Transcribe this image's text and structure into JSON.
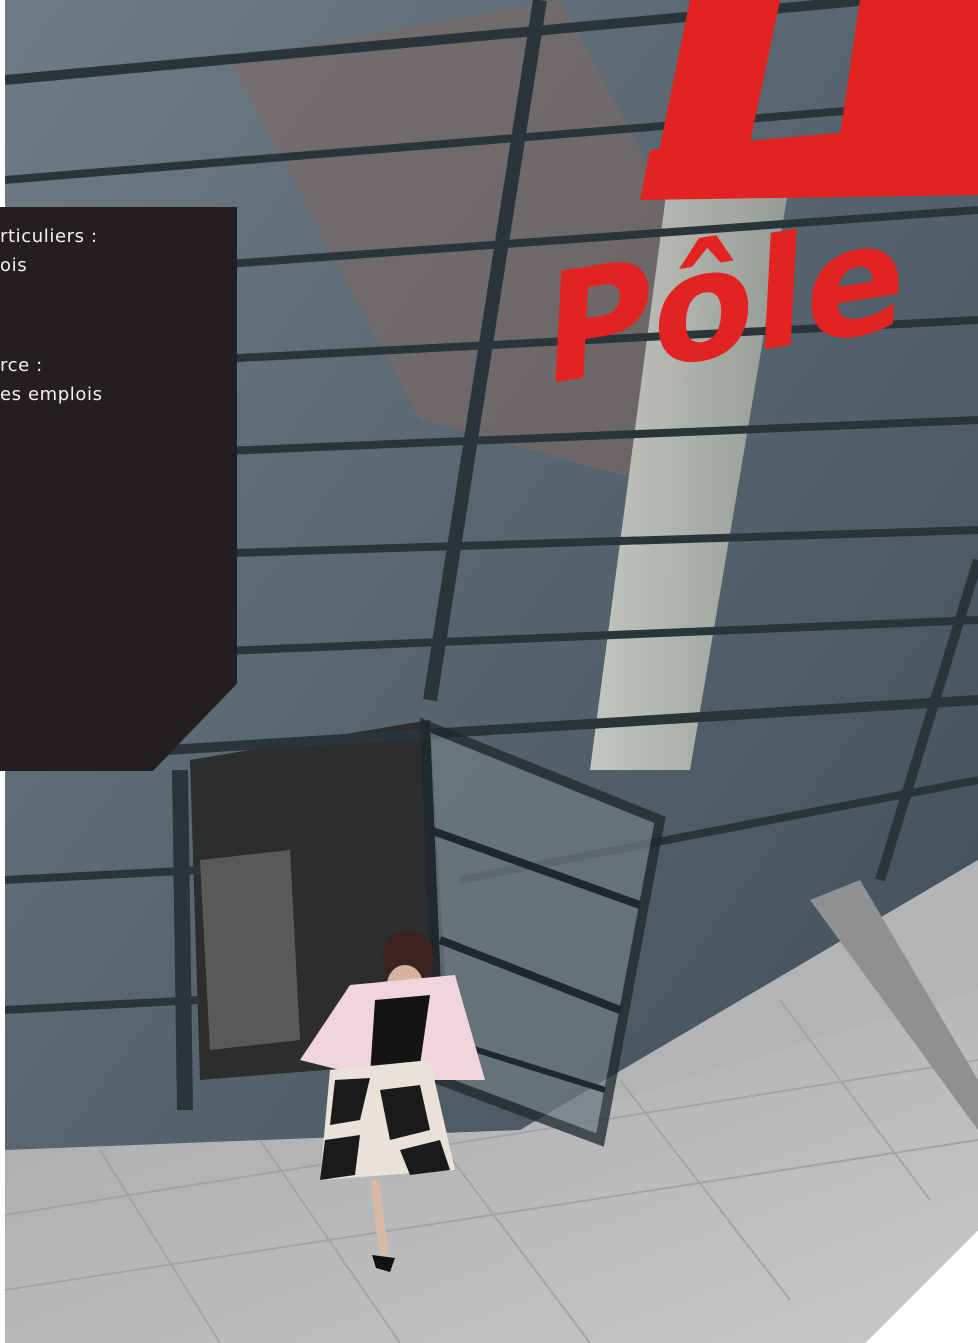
{
  "photo": {
    "description_icon": "building-entrance-photo",
    "sign_color": "#e32322",
    "glass_color": "#5c6a75",
    "frame_color": "#2a353b",
    "pavement_color": "#b9babb"
  },
  "panel": {
    "background": "#231f20",
    "lines": [
      "rticuliers :",
      "ois",
      "rce :",
      "es emplois"
    ]
  },
  "sign": {
    "line1": "LE",
    "line2": "Pôle"
  }
}
